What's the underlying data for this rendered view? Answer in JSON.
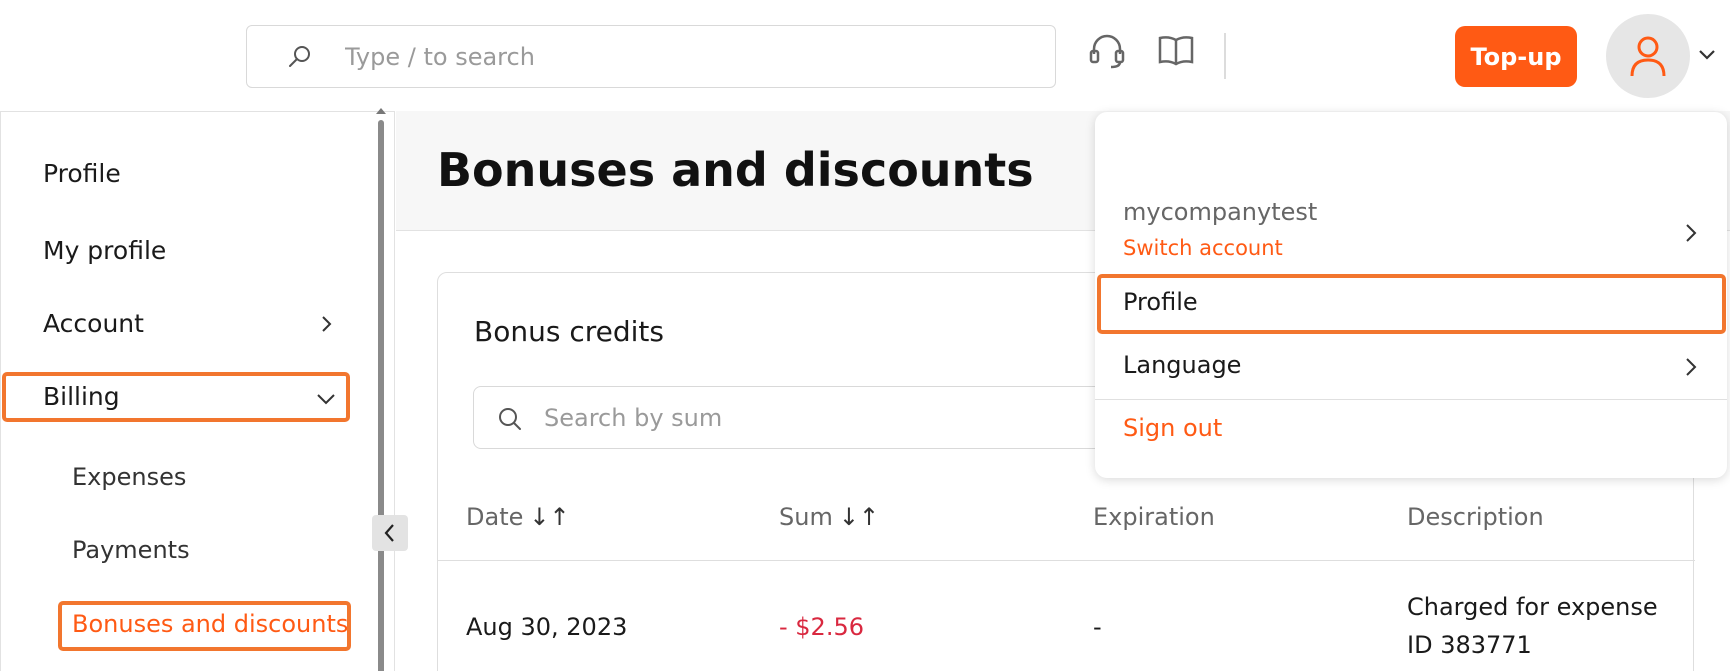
{
  "header": {
    "search_placeholder": "Type / to search",
    "support_icon": "headset-icon",
    "docs_icon": "book-icon",
    "topup_label": "Top-up",
    "avatar_icon": "user-icon"
  },
  "sidebar": {
    "section_title": "Profile",
    "items": [
      {
        "label": "My profile"
      },
      {
        "label": "Account"
      },
      {
        "label": "Billing"
      }
    ],
    "billing_sub": [
      {
        "label": "Expenses"
      },
      {
        "label": "Payments"
      },
      {
        "label": "Bonuses and discounts"
      }
    ]
  },
  "main": {
    "page_title": "Bonuses and discounts",
    "card": {
      "title": "Bonus credits",
      "search_placeholder": "Search by sum",
      "columns": [
        "Date",
        "Sum",
        "Expiration",
        "Description"
      ],
      "sort_glyph": "↓↑",
      "rows": [
        {
          "date": "Aug 30, 2023",
          "sum": "- $2.56",
          "expiration": "-",
          "description_line1": "Charged for expense",
          "description_line2": "ID 383771"
        }
      ]
    }
  },
  "dropdown": {
    "account_name": "mycompanytest",
    "switch_label": "Switch account",
    "profile_label": "Profile",
    "language_label": "Language",
    "signout_label": "Sign out"
  },
  "colors": {
    "accent": "#ff5a14",
    "highlight": "#f2762e",
    "negative": "#d9283f"
  }
}
